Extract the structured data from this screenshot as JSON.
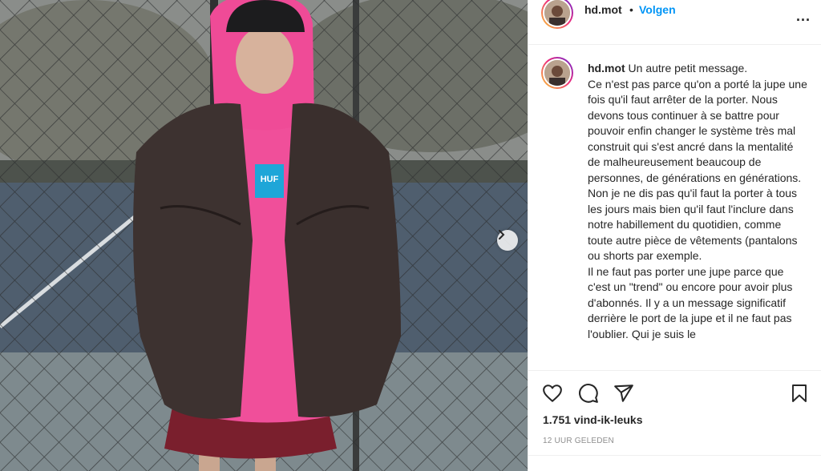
{
  "post": {
    "username": "hd.mot",
    "follow_label": "Volgen",
    "separator": "•",
    "more_icon": "...",
    "caption_username": "hd.mot",
    "caption": "Un autre petit message.\nCe n'est pas parce qu'on a porté la jupe une fois qu'il faut arrêter de la porter. Nous devons tous continuer à se battre pour pouvoir enfin changer le système très mal construit qui s'est ancré dans la mentalité de malheureusement beaucoup de personnes, de générations en générations. Non je ne dis pas qu'il faut la porter à tous les jours mais bien qu'il faut l'inclure dans notre habillement du quotidien, comme toute autre pièce de vêtements (pantalons ou shorts par exemple.\nIl ne faut pas porter une jupe parce que c'est un \"trend\" ou encore pour avoir plus d'abonnés. Il y a un message significatif derrière le port de la jupe et il ne faut pas l'oublier. Qui je suis le",
    "likes": "1.751 vind-ik-leuks",
    "timestamp": "12 UUR GELEDEN",
    "photo_logo": "HUF"
  },
  "icons": {
    "like": "heart-icon",
    "comment": "comment-icon",
    "share": "share-icon",
    "save": "bookmark-icon",
    "next": "chevron-right-icon"
  },
  "colors": {
    "accent": "#0095f6",
    "hoodie": "#f04f9a",
    "jacket": "#3d3230",
    "skirt": "#7a1f2d",
    "logo_box": "#1ea6d8"
  }
}
